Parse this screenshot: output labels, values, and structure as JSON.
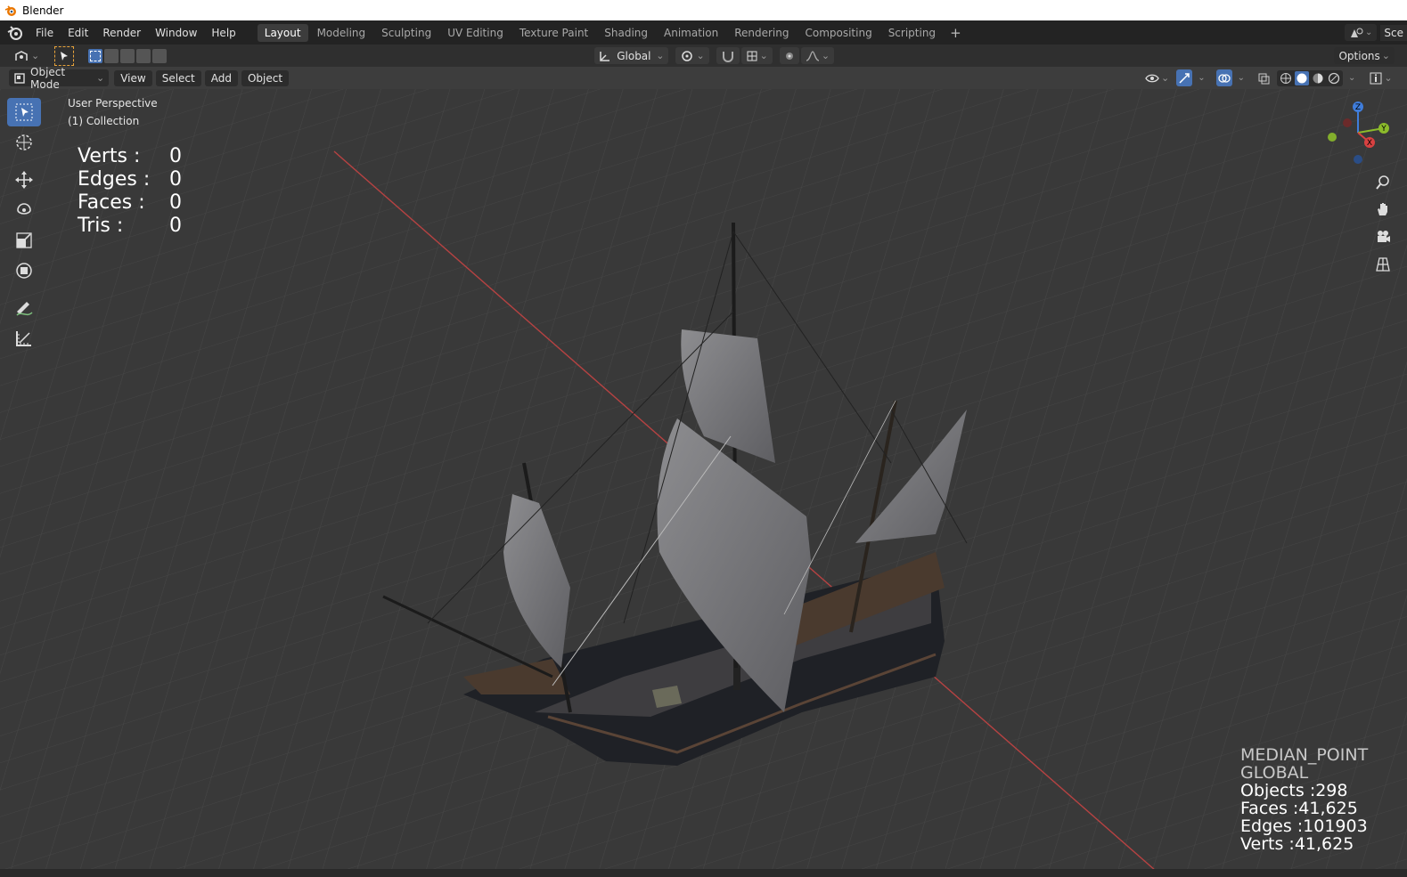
{
  "window": {
    "title": "Blender"
  },
  "menubar": {
    "items": [
      "File",
      "Edit",
      "Render",
      "Window",
      "Help"
    ],
    "workspaces": [
      "Layout",
      "Modeling",
      "Sculpting",
      "UV Editing",
      "Texture Paint",
      "Shading",
      "Animation",
      "Rendering",
      "Compositing",
      "Scripting"
    ],
    "active_workspace": "Layout",
    "scene_label": "Sce"
  },
  "toolheader": {
    "orientation": "Global",
    "options_label": "Options"
  },
  "viewheader": {
    "mode": "Object Mode",
    "menus": [
      "View",
      "Select",
      "Add",
      "Object"
    ]
  },
  "viewport": {
    "perspective": "User Perspective",
    "collection": "(1) Collection",
    "selection_stats": [
      {
        "label": "Verts :",
        "value": "0"
      },
      {
        "label": "Edges :",
        "value": "0"
      },
      {
        "label": "Faces :",
        "value": "0"
      },
      {
        "label": "Tris :",
        "value": "0"
      }
    ],
    "pivot": "MEDIAN_POINT",
    "orientation": "GLOBAL",
    "scene_stats": [
      "Objects :298",
      "Faces :41,625",
      "Edges :101903",
      "Verts :41,625"
    ],
    "gizmo_axes": [
      "Z",
      "Y",
      "X"
    ]
  },
  "colors": {
    "accent": "#4772b3",
    "x_axis": "#d84141",
    "y_axis": "#8cbb2b",
    "z_axis": "#3f7ddb"
  }
}
